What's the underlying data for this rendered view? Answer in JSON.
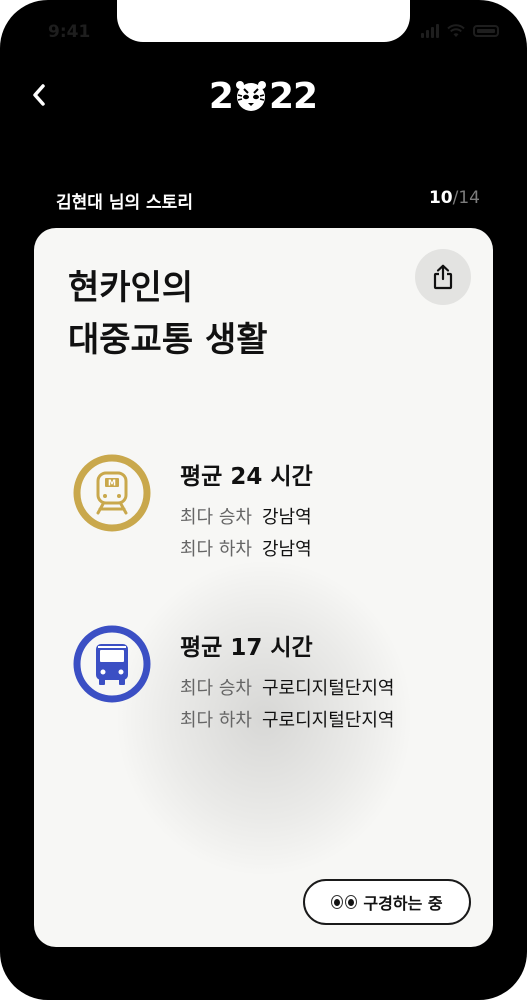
{
  "status_bar": {
    "time": "9:41"
  },
  "header": {
    "back_icon": "chevron-left-icon",
    "logo_left": "2",
    "logo_right": "22",
    "logo_mascot": "tiger-face-icon"
  },
  "story": {
    "owner_label": "김현대 님의 스토리",
    "page_current": "10",
    "page_separator": "/",
    "page_total": "14"
  },
  "card": {
    "title_line1": "현카인의",
    "title_line2": "대중교통 생활",
    "share_icon": "share-icon",
    "transit": [
      {
        "mode_icon": "subway-icon",
        "accent": "#c9a84c",
        "average": "평균 24 시간",
        "top_boarding_label": "최다 승차",
        "top_boarding_value": "강남역",
        "top_alighting_label": "최다 하차",
        "top_alighting_value": "강남역"
      },
      {
        "mode_icon": "bus-icon",
        "accent": "#3b4fc4",
        "average": "평균 17 시간",
        "top_boarding_label": "최다 승차",
        "top_boarding_value": "구로디지털단지역",
        "top_alighting_label": "최다 하차",
        "top_alighting_value": "구로디지털단지역"
      }
    ],
    "browsing_label": "구경하는 중",
    "browsing_icon": "eyes-icon"
  },
  "colors": {
    "background": "#000000",
    "card": "#f7f7f5",
    "subway_gold": "#c9a84c",
    "bus_blue": "#3b4fc4"
  }
}
